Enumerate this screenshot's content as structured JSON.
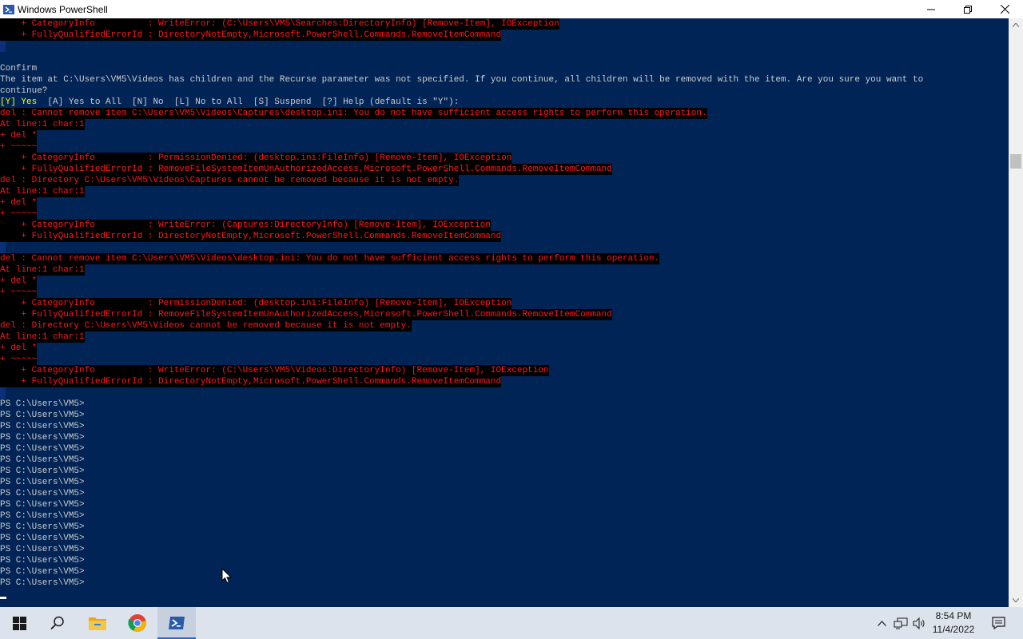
{
  "window": {
    "title": "Windows PowerShell",
    "minimize_icon": "minimize-icon",
    "restore_icon": "restore-icon",
    "close_icon": "close-icon"
  },
  "colors": {
    "console_bg": "#012456",
    "error_text": "#ff1818",
    "error_bg": "#000000",
    "normal_text": "#cccccc",
    "selection_bg": "#0c2f7a",
    "highlight_text": "#ffff00"
  },
  "console": {
    "lines": [
      {
        "segs": [
          {
            "t": "    + CategoryInfo          : WriteError: (C:\\Users\\VM5\\Searches:DirectoryInfo) [Remove-Item], IOException",
            "c": "err"
          }
        ]
      },
      {
        "segs": [
          {
            "t": "    + FullyQualifiedErrorId : DirectoryNotEmpty,Microsoft.PowerShell.Commands.RemoveItemCommand",
            "c": "err"
          }
        ]
      },
      {
        "segs": [
          {
            "t": " ",
            "c": "sel"
          }
        ]
      },
      {
        "segs": [
          {
            "t": "",
            "c": "norm"
          }
        ]
      },
      {
        "segs": [
          {
            "t": "Confirm",
            "c": "norm"
          }
        ]
      },
      {
        "segs": [
          {
            "t": "The item at C:\\Users\\VM5\\Videos has children and the Recurse parameter was not specified. If you continue, all children will be removed with the item. Are you sure you want to",
            "c": "norm"
          }
        ]
      },
      {
        "segs": [
          {
            "t": "continue?",
            "c": "norm"
          }
        ]
      },
      {
        "segs": [
          {
            "t": "[Y] Yes",
            "c": "ylw"
          },
          {
            "t": "  [A] Yes to All  [N] No  [L] No to All  [S] Suspend  [?] Help (default is \"Y\"):",
            "c": "norm"
          }
        ]
      },
      {
        "segs": [
          {
            "t": "del : Cannot remove item C:\\Users\\VM5\\Videos\\Captures\\desktop.ini: You do not have sufficient access rights to perform this operation.",
            "c": "err"
          }
        ]
      },
      {
        "segs": [
          {
            "t": "At line:1 char:1",
            "c": "err"
          }
        ]
      },
      {
        "segs": [
          {
            "t": "+ del *",
            "c": "err"
          }
        ]
      },
      {
        "segs": [
          {
            "t": "+ ~~~~~",
            "c": "err"
          }
        ]
      },
      {
        "segs": [
          {
            "t": "    + CategoryInfo          : PermissionDenied: (desktop.ini:FileInfo) [Remove-Item], IOException",
            "c": "err"
          }
        ]
      },
      {
        "segs": [
          {
            "t": "    + FullyQualifiedErrorId : RemoveFileSystemItemUnAuthorizedAccess,Microsoft.PowerShell.Commands.RemoveItemCommand",
            "c": "err"
          }
        ]
      },
      {
        "segs": [
          {
            "t": "del : Directory C:\\Users\\VM5\\Videos\\Captures cannot be removed because it is not empty.",
            "c": "err"
          }
        ]
      },
      {
        "segs": [
          {
            "t": "At line:1 char:1",
            "c": "err"
          }
        ]
      },
      {
        "segs": [
          {
            "t": "+ del *",
            "c": "err"
          }
        ]
      },
      {
        "segs": [
          {
            "t": "+ ~~~~~",
            "c": "err"
          }
        ]
      },
      {
        "segs": [
          {
            "t": "    + CategoryInfo          : WriteError: (Captures:DirectoryInfo) [Remove-Item], IOException",
            "c": "err"
          }
        ]
      },
      {
        "segs": [
          {
            "t": "    + FullyQualifiedErrorId : DirectoryNotEmpty,Microsoft.PowerShell.Commands.RemoveItemCommand",
            "c": "err"
          }
        ]
      },
      {
        "segs": [
          {
            "t": " ",
            "c": "sel"
          }
        ]
      },
      {
        "segs": [
          {
            "t": "del : Cannot remove item C:\\Users\\VM5\\Videos\\desktop.ini: You do not have sufficient access rights to perform this operation.",
            "c": "err"
          }
        ]
      },
      {
        "segs": [
          {
            "t": "At line:1 char:1",
            "c": "err"
          }
        ]
      },
      {
        "segs": [
          {
            "t": "+ del *",
            "c": "err"
          }
        ]
      },
      {
        "segs": [
          {
            "t": "+ ~~~~~",
            "c": "err"
          }
        ]
      },
      {
        "segs": [
          {
            "t": "    + CategoryInfo          : PermissionDenied: (desktop.ini:FileInfo) [Remove-Item], IOException",
            "c": "err"
          }
        ]
      },
      {
        "segs": [
          {
            "t": "    + FullyQualifiedErrorId : RemoveFileSystemItemUnAuthorizedAccess,Microsoft.PowerShell.Commands.RemoveItemCommand",
            "c": "err"
          }
        ]
      },
      {
        "segs": [
          {
            "t": "del : Directory C:\\Users\\VM5\\Videos cannot be removed because it is not empty.",
            "c": "err"
          }
        ]
      },
      {
        "segs": [
          {
            "t": "At line:1 char:1",
            "c": "err"
          }
        ]
      },
      {
        "segs": [
          {
            "t": "+ del *",
            "c": "err"
          }
        ]
      },
      {
        "segs": [
          {
            "t": "+ ~~~~~",
            "c": "err"
          }
        ]
      },
      {
        "segs": [
          {
            "t": "    + CategoryInfo          : WriteError: (C:\\Users\\VM5\\Videos:DirectoryInfo) [Remove-Item], IOException",
            "c": "err"
          }
        ]
      },
      {
        "segs": [
          {
            "t": "    + FullyQualifiedErrorId : DirectoryNotEmpty,Microsoft.PowerShell.Commands.RemoveItemCommand",
            "c": "err"
          }
        ]
      },
      {
        "segs": [
          {
            "t": " ",
            "c": "sel"
          }
        ]
      },
      {
        "segs": [
          {
            "t": "PS C:\\Users\\VM5>",
            "c": "norm"
          }
        ]
      },
      {
        "segs": [
          {
            "t": "PS C:\\Users\\VM5>",
            "c": "norm"
          }
        ]
      },
      {
        "segs": [
          {
            "t": "PS C:\\Users\\VM5>",
            "c": "norm"
          }
        ]
      },
      {
        "segs": [
          {
            "t": "PS C:\\Users\\VM5>",
            "c": "norm"
          }
        ]
      },
      {
        "segs": [
          {
            "t": "PS C:\\Users\\VM5>",
            "c": "norm"
          }
        ]
      },
      {
        "segs": [
          {
            "t": "PS C:\\Users\\VM5>",
            "c": "norm"
          }
        ]
      },
      {
        "segs": [
          {
            "t": "PS C:\\Users\\VM5>",
            "c": "norm"
          }
        ]
      },
      {
        "segs": [
          {
            "t": "PS C:\\Users\\VM5>",
            "c": "norm"
          }
        ]
      },
      {
        "segs": [
          {
            "t": "PS C:\\Users\\VM5>",
            "c": "norm"
          }
        ]
      },
      {
        "segs": [
          {
            "t": "PS C:\\Users\\VM5>",
            "c": "norm"
          }
        ]
      },
      {
        "segs": [
          {
            "t": "PS C:\\Users\\VM5>",
            "c": "norm"
          }
        ]
      },
      {
        "segs": [
          {
            "t": "PS C:\\Users\\VM5>",
            "c": "norm"
          }
        ]
      },
      {
        "segs": [
          {
            "t": "PS C:\\Users\\VM5>",
            "c": "norm"
          }
        ]
      },
      {
        "segs": [
          {
            "t": "PS C:\\Users\\VM5>",
            "c": "norm"
          }
        ]
      },
      {
        "segs": [
          {
            "t": "PS C:\\Users\\VM5>",
            "c": "norm"
          }
        ]
      },
      {
        "segs": [
          {
            "t": "PS C:\\Users\\VM5>",
            "c": "norm"
          }
        ]
      },
      {
        "segs": [
          {
            "t": "PS C:\\Users\\VM5>",
            "c": "norm"
          }
        ]
      }
    ]
  },
  "taskbar": {
    "start_icon": "windows-start-icon",
    "search_icon": "search-icon",
    "apps": [
      {
        "name": "file-explorer-icon"
      },
      {
        "name": "chrome-icon"
      },
      {
        "name": "powershell-icon",
        "active": true
      }
    ],
    "tray": {
      "chevron_icon": "chevron-up-icon",
      "network_icon": "network-icon",
      "volume_icon": "volume-icon",
      "time": "8:54 PM",
      "date": "11/4/2022",
      "notifications_icon": "notifications-icon"
    }
  }
}
